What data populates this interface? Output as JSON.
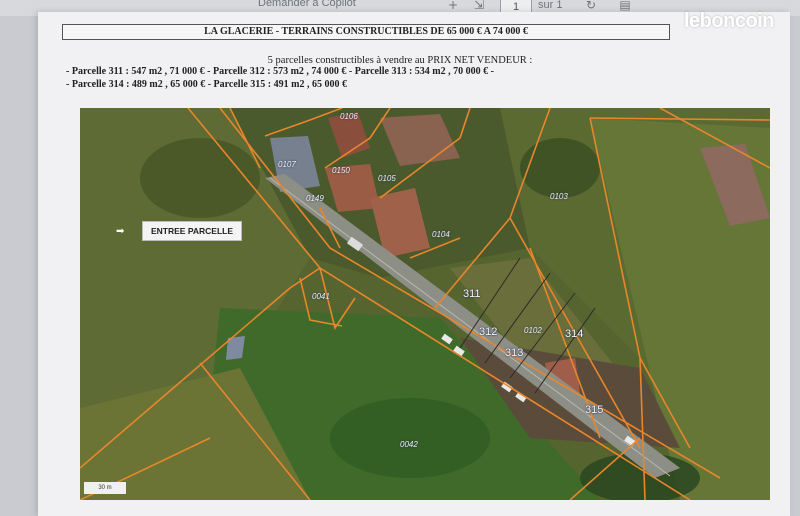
{
  "viewer": {
    "toolbar_text": "Demander à Copilot",
    "page_number": "1",
    "page_total": "sur 1"
  },
  "brand": {
    "logo_text": "leboncoin"
  },
  "document": {
    "title": "LA GLACERIE - TERRAINS CONSTRUCTIBLES DE 65 000 € A 74 000 €",
    "subtitle": "5 parcelles constructibles à vendre au PRIX NET VENDEUR :",
    "line1": "-  Parcelle  311 : 547 m2 , 71 000 € - Parcelle  312 : 573 m2 , 74 000 € - Parcelle  313 : 534 m2 , 70 000 € -",
    "line2": "-  Parcelle  314 : 489 m2 , 65 000 € - Parcelle  315 : 491 m2 ,  65 000 €"
  },
  "map": {
    "entree_label": "ENTREE PARCELLE",
    "scale_label": "30 m",
    "cadastral_labels": [
      "0106",
      "0107",
      "0150",
      "0105",
      "0149",
      "0104",
      "0103",
      "0041",
      "0102",
      "0042"
    ],
    "parcels": [
      "311",
      "312",
      "313",
      "314",
      "315"
    ]
  }
}
